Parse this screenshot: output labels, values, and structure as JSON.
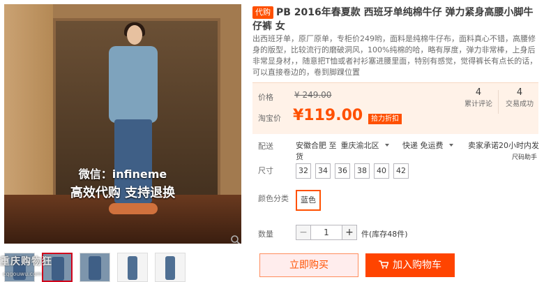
{
  "gallery": {
    "watermark_line1": "微信：infineme",
    "watermark_line2": "高效代购  支持退换",
    "site_watermark": "重庆购物狂",
    "site_url": "cqgouwu.com",
    "thumbnails": [
      {
        "kind": "photo",
        "active": false
      },
      {
        "kind": "photo",
        "active": true
      },
      {
        "kind": "photo",
        "active": false
      },
      {
        "kind": "jeans",
        "active": false
      },
      {
        "kind": "jeans",
        "active": false
      }
    ],
    "zoom_icon": "magnifier-icon"
  },
  "product": {
    "tag": "代购",
    "title": "PB 2016年春夏款 西班牙单纯棉牛仔 弹力紧身高腰小脚牛仔裤 女",
    "description": "出西班牙单，原厂原单，专柜价249哟，面料是纯棉牛仔布，面料真心不错，高腰修身的版型，比较流行的磨破洞风，100%纯棉的哈，略有厚度，弹力非常棒，上身后非常显身材，，随意把T恤或者衬衫塞进腰里面，特别有感觉，觉得裤长有点长的话，可以直接卷边的，卷到脚踝位置"
  },
  "price": {
    "price_label": "价格",
    "original": "¥ 249.00",
    "taobao_label": "淘宝价",
    "current": "¥119.00",
    "promo": "拾力折扣",
    "stats": [
      {
        "num": "4",
        "label": "累计评论"
      },
      {
        "num": "4",
        "label": "交易成功"
      }
    ]
  },
  "shipping": {
    "label": "配送",
    "from": "安徽合肥 至",
    "to": "重庆渝北区",
    "method": "快递 免运费",
    "promise": "卖家承诺20小时内发货",
    "code_help": "尺码助手"
  },
  "sizes": {
    "label": "尺寸",
    "options": [
      "32",
      "34",
      "36",
      "38",
      "40",
      "42"
    ]
  },
  "colors": {
    "label": "颜色分类",
    "selected": "蓝色"
  },
  "quantity": {
    "label": "数量",
    "value": "1",
    "minus": "−",
    "plus": "+",
    "stock": "件(库存48件)"
  },
  "actions": {
    "buy_now": "立即购买",
    "add_to_cart": "加入购物车"
  },
  "colors_theme": {
    "accent": "#ff5000",
    "cart_bg": "#ff4400",
    "price_bg": "#fff2e8",
    "selected_border": "#d0021b"
  }
}
